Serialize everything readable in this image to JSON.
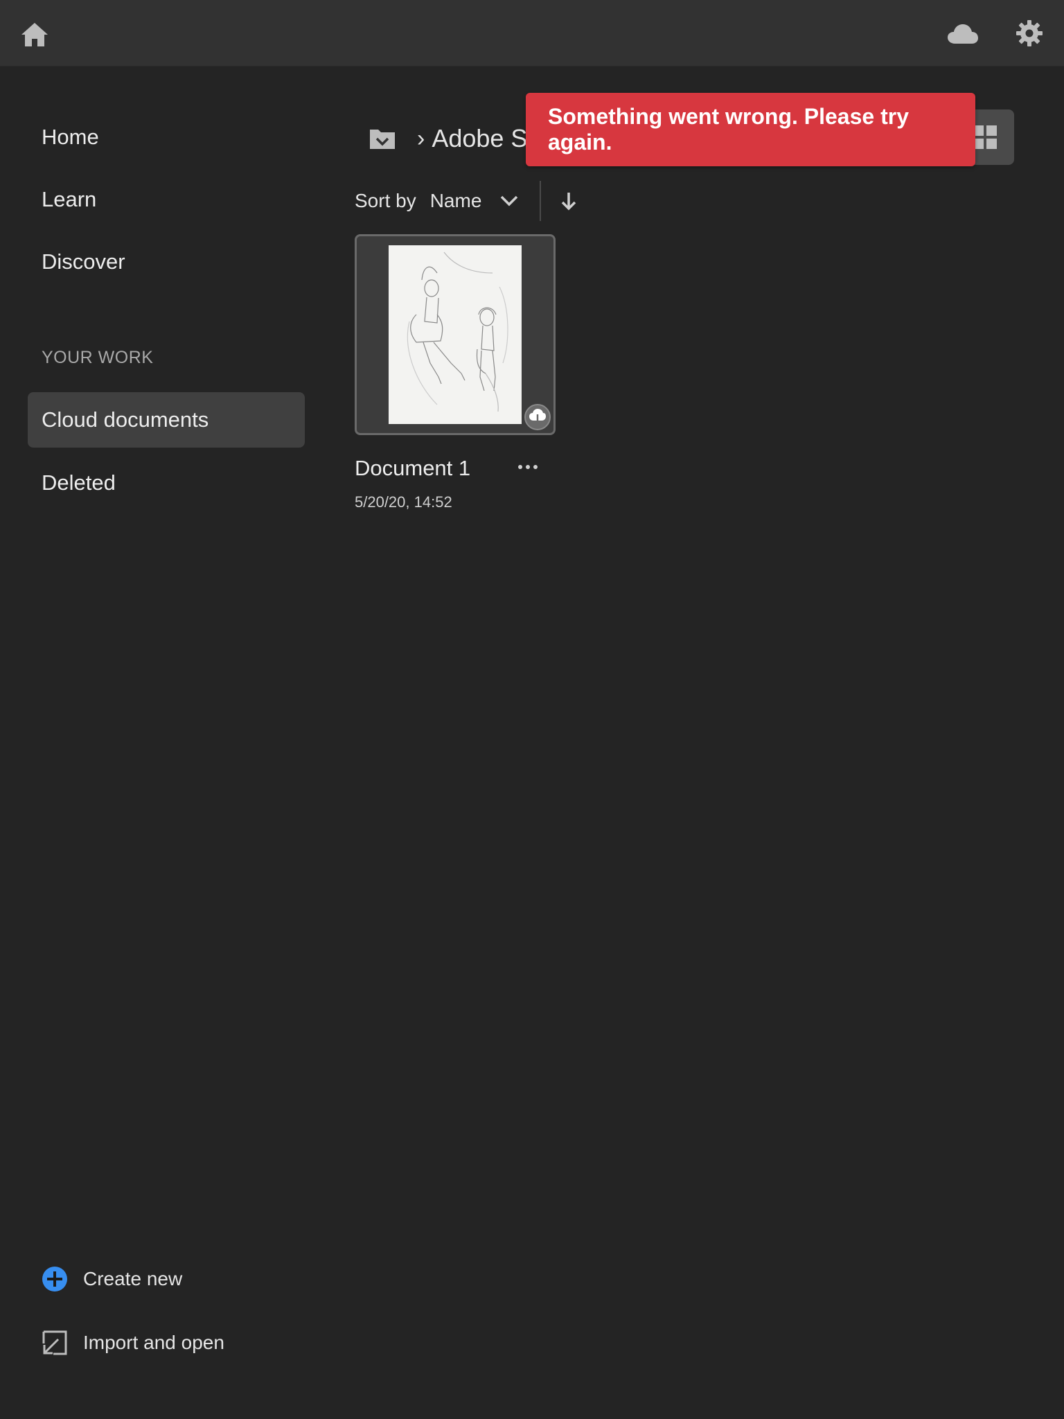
{
  "topbar": {
    "home_icon": "home-icon",
    "cloud_icon": "cloud-icon",
    "settings_icon": "gear-icon"
  },
  "sidebar": {
    "items": [
      {
        "label": "Home"
      },
      {
        "label": "Learn"
      },
      {
        "label": "Discover"
      }
    ],
    "section_label": "YOUR WORK",
    "work_items": [
      {
        "label": "Cloud documents",
        "active": true
      },
      {
        "label": "Deleted",
        "active": false
      }
    ],
    "create_new_label": "Create new",
    "import_label": "Import and open"
  },
  "breadcrumb": {
    "current": "Adobe Sketch"
  },
  "sort": {
    "label": "Sort by",
    "value": "Name"
  },
  "documents": [
    {
      "name": "Document 1",
      "date": "5/20/20, 14:52"
    }
  ],
  "toast": {
    "message": "Something went wrong. Please try again."
  },
  "colors": {
    "background": "#242424",
    "topbar": "#323232",
    "active_item": "#404040",
    "toast": "#d7373f",
    "accent_blue": "#378ef0"
  }
}
